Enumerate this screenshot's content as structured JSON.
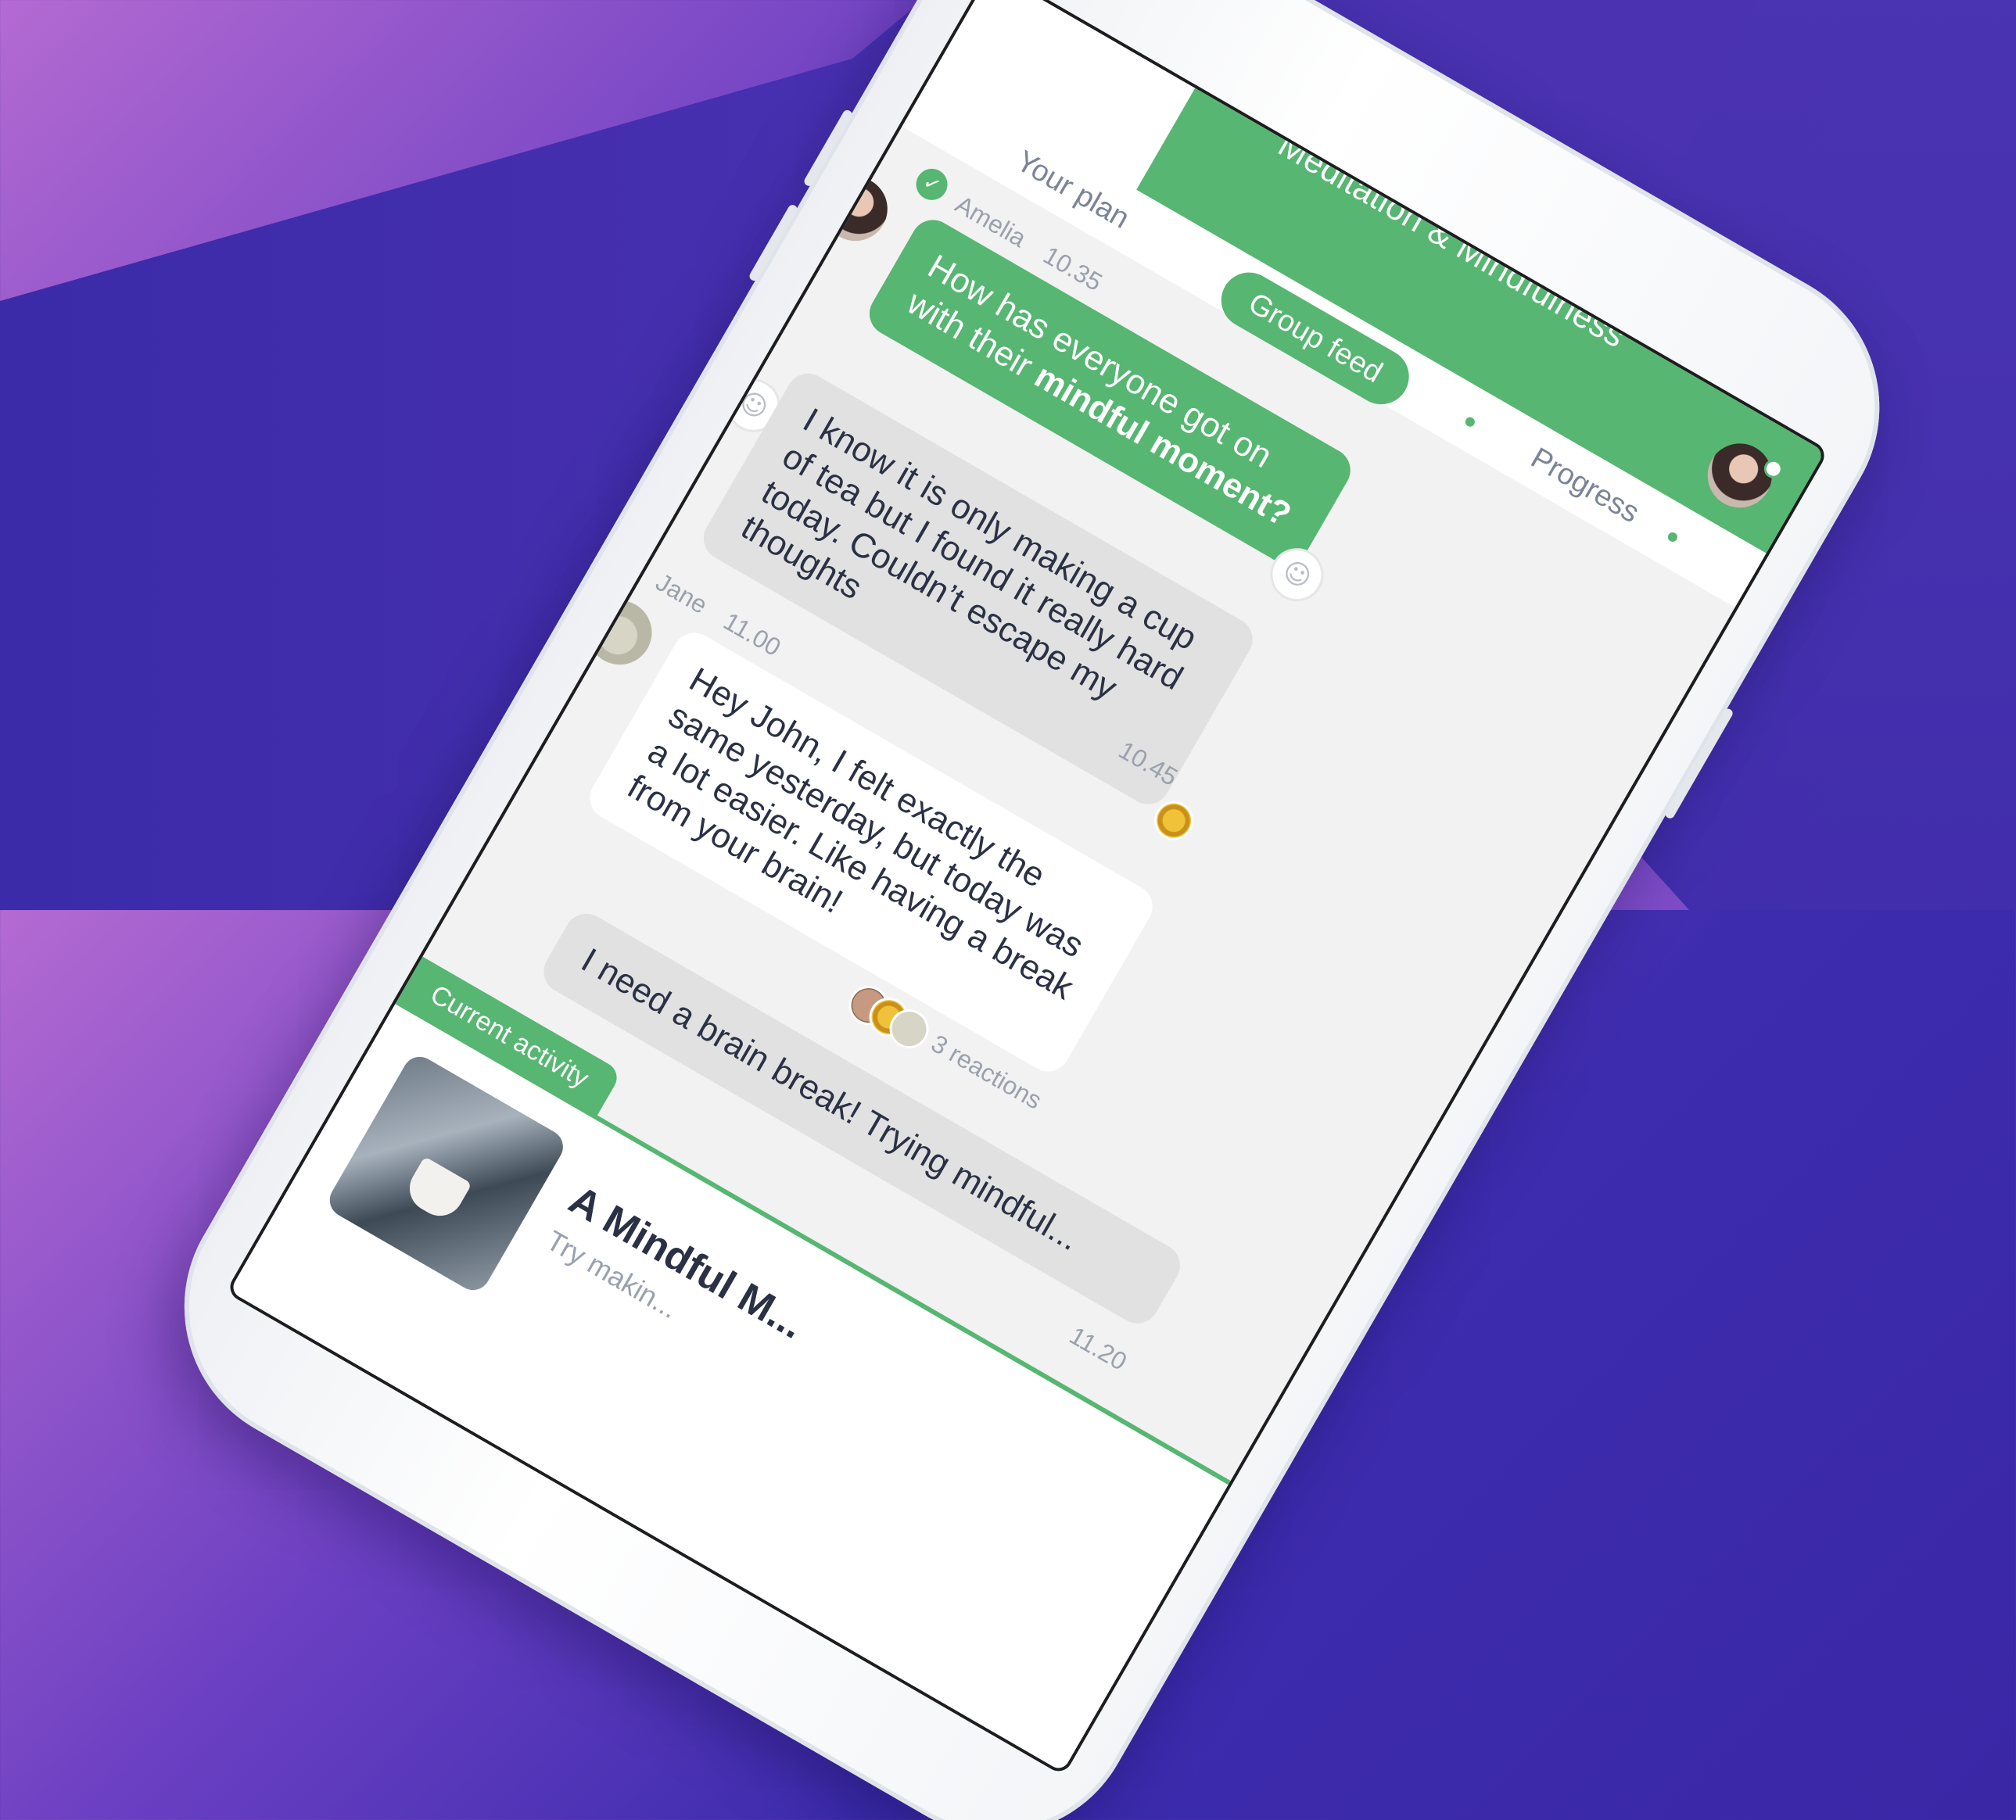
{
  "colors": {
    "accent": "#56b672",
    "text": "#2a3145",
    "muted": "#9aa1ad"
  },
  "header": {
    "title": "Meditation & Mindfulness",
    "tabs": {
      "left": "Your plan",
      "active": "Group feed",
      "right": "Progress"
    }
  },
  "messages": [
    {
      "author": "Amelia",
      "time": "10.35",
      "text_before": "How has everyone got on with their ",
      "text_bold": "mindful moment?"
    },
    {
      "author": "",
      "time": "10.45",
      "text": "I know it is only making a cup of tea but I found it really hard today. Couldn’t escape my thoughts"
    },
    {
      "author": "Jane",
      "time": "11.00",
      "text": "Hey John, I felt exactly the same yesterday, but today was a lot easier. Like having a break from your brain!",
      "reactions": "3 reactions"
    },
    {
      "author": "",
      "time": "11.20",
      "text": "I need a brain break! Trying mindful..."
    }
  ],
  "activity": {
    "tag": "Current activity",
    "title": "A Mindful M...",
    "subtitle": "Try makin..."
  },
  "icons": [
    "check-icon",
    "smiley-add-icon",
    "online-dot-icon"
  ]
}
